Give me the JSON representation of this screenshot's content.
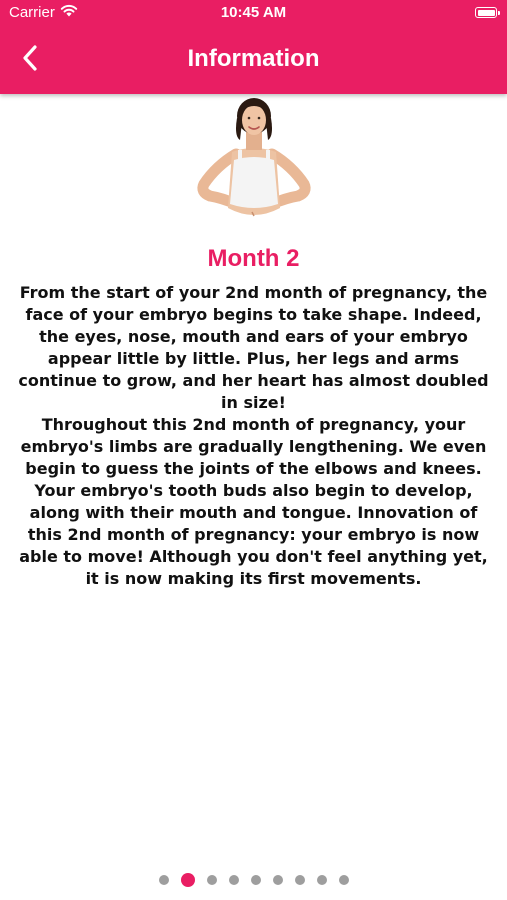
{
  "status_bar": {
    "carrier": "Carrier",
    "time": "10:45 AM"
  },
  "nav": {
    "title": "Information"
  },
  "content": {
    "title": "Month 2",
    "body": "From the start of your 2nd month of pregnancy, the face of your embryo begins to take shape. Indeed, the eyes, nose, mouth and ears of your embryo appear little by little. Plus, her legs and arms continue to grow, and her heart has almost doubled in size!\nThroughout this 2nd month of pregnancy, your embryo's limbs are gradually lengthening. We even begin to guess the joints of the elbows and knees. Your embryo's tooth buds also begin to develop, along with their mouth and tongue. Innovation of this 2nd month of pregnancy: your embryo is now able to move! Although you don't feel anything yet, it is now making its first movements."
  },
  "pagination": {
    "total": 9,
    "active_index": 1
  },
  "colors": {
    "accent": "#e91e63",
    "dot_inactive": "#9e9e9e"
  }
}
